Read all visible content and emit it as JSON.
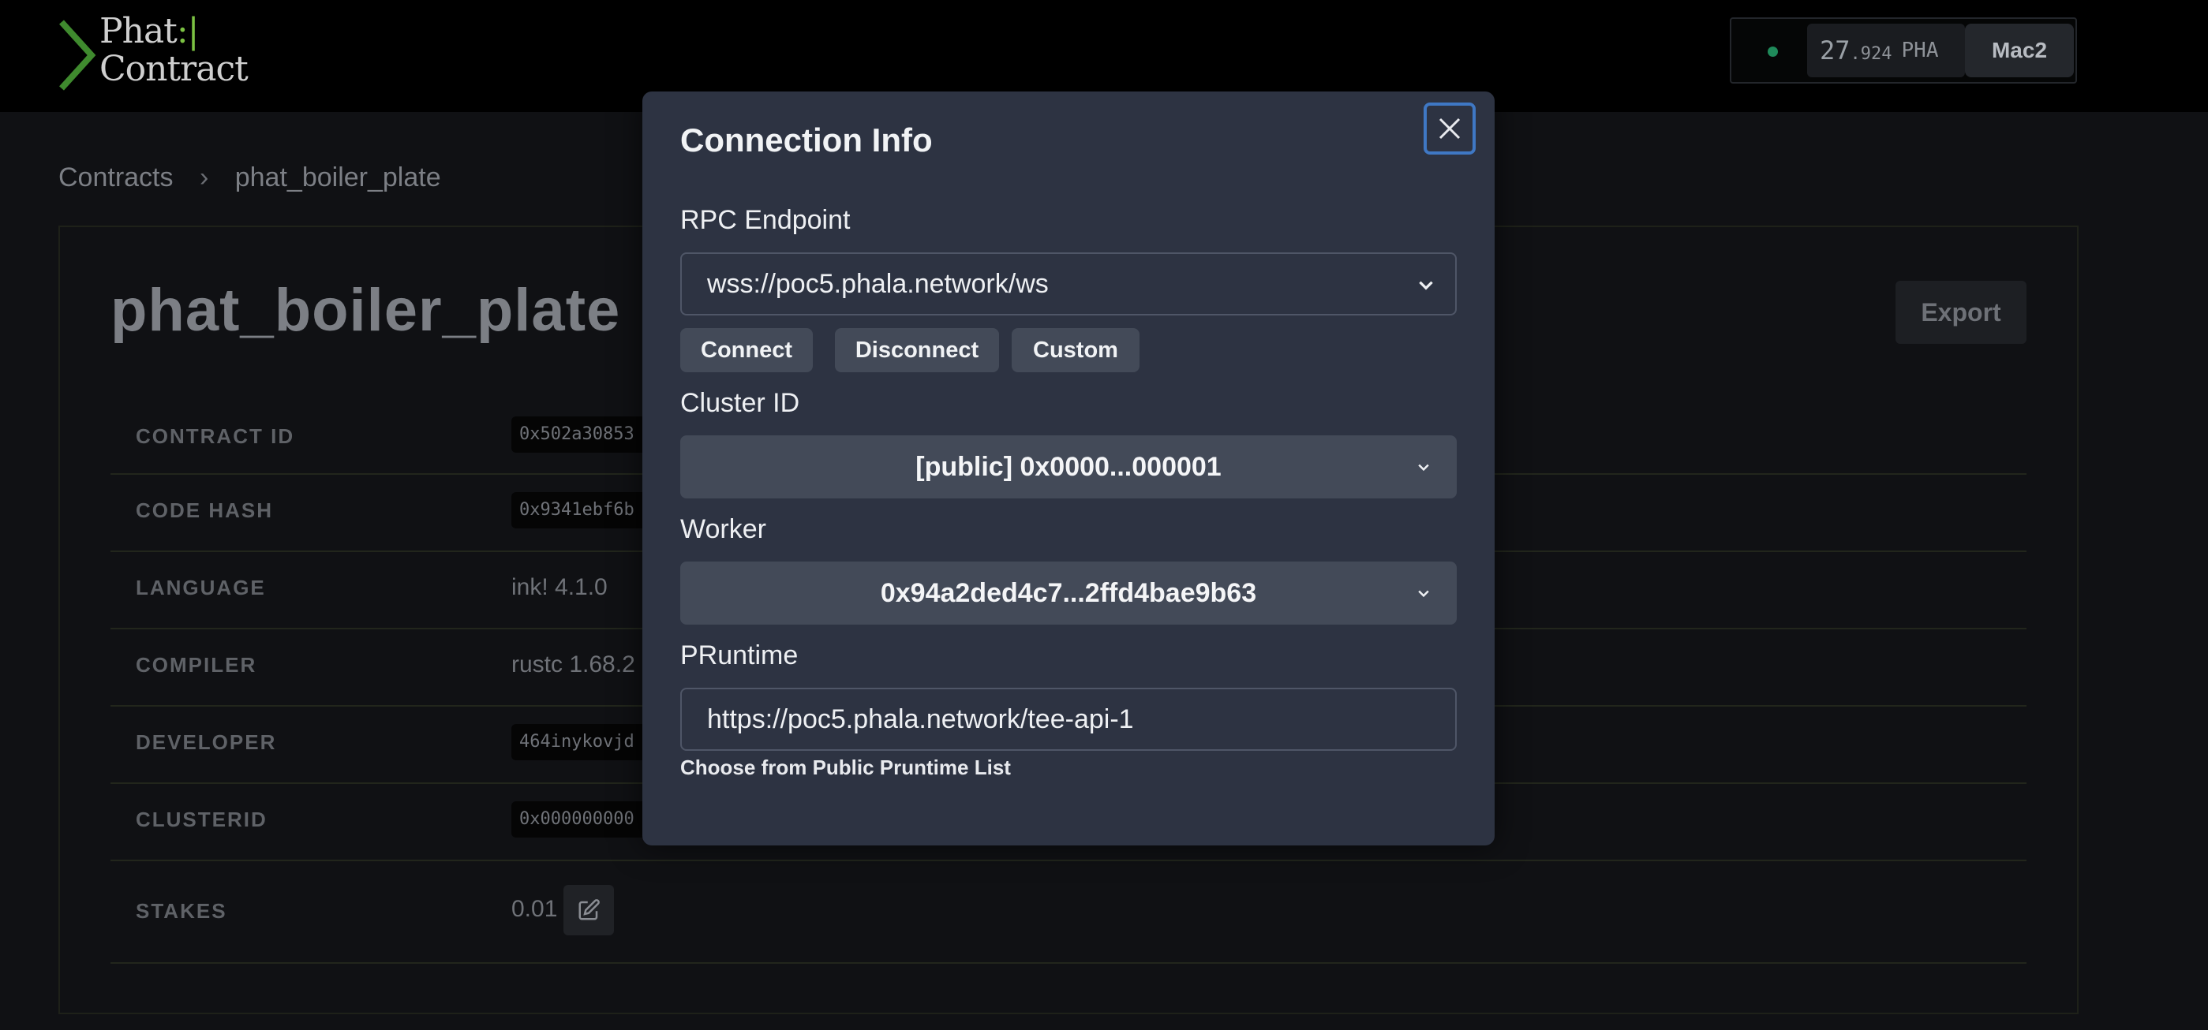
{
  "header": {
    "logo_line1": "Phat",
    "logo_line1_suffix": ":|",
    "logo_line2": "Contract",
    "balance_int": "27",
    "balance_dec": ".924",
    "balance_unit": "PHA",
    "account_name": "Mac2",
    "status_color": "#1f8a5a"
  },
  "breadcrumb": {
    "root": "Contracts",
    "separator": "›",
    "current": "phat_boiler_plate"
  },
  "contract": {
    "title": "phat_boiler_plate",
    "export_label": "Export",
    "rows": [
      {
        "key": "CONTRACT ID",
        "value": "0x502a30853"
      },
      {
        "key": "CODE HASH",
        "value": "0x9341ebf6b"
      },
      {
        "key": "LANGUAGE",
        "value": "ink! 4.1.0"
      },
      {
        "key": "COMPILER",
        "value": "rustc 1.68.2"
      },
      {
        "key": "DEVELOPER",
        "value": "464inykovjd"
      },
      {
        "key": "CLUSTERID",
        "value": "0x000000000"
      },
      {
        "key": "STAKES",
        "value": "0.01"
      }
    ]
  },
  "modal": {
    "title": "Connection Info",
    "rpc_label": "RPC Endpoint",
    "rpc_value": "wss://poc5.phala.network/ws",
    "connect_label": "Connect",
    "disconnect_label": "Disconnect",
    "custom_label": "Custom",
    "cluster_label": "Cluster ID",
    "cluster_value": "[public] 0x0000...000001",
    "worker_label": "Worker",
    "worker_value": "0x94a2ded4c7...2ffd4bae9b63",
    "pruntime_label": "PRuntime",
    "pruntime_value": "https://poc5.phala.network/tee-api-1",
    "pruntime_hint": "Choose from Public Pruntime List"
  },
  "colors": {
    "accent_focus": "#3f78c4",
    "logo_green": "#7cc243",
    "modal_bg": "#2d3342"
  }
}
